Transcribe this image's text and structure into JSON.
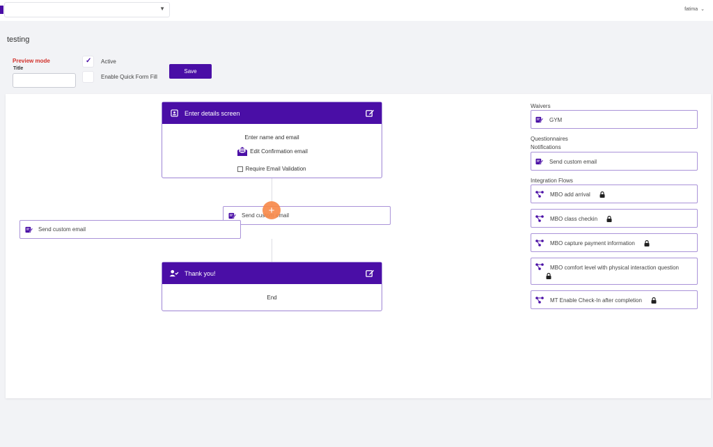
{
  "topbar": {
    "user_name": "fatima"
  },
  "page": {
    "title": "testing"
  },
  "form": {
    "preview_mode_label": "Preview mode",
    "title_label": "Title",
    "title_value": "",
    "active_label": "Active",
    "active_checked": true,
    "quick_fill_label": "Enable Quick Form Fill",
    "quick_fill_checked": false,
    "save_label": "Save"
  },
  "flow": {
    "details_node": {
      "title": "Enter details screen",
      "line1": "Enter name and email",
      "confirmation_link": "Edit Confirmation email",
      "validation_label": "Require Email Validation"
    },
    "middle_action": {
      "label": "Send custom email"
    },
    "left_action": {
      "label": "Send custom email"
    },
    "add_symbol": "+",
    "thanks_node": {
      "title": "Thank you!",
      "body": "End"
    }
  },
  "sidebar": {
    "waivers_label": "Waivers",
    "waivers": [
      {
        "label": "GYM"
      }
    ],
    "questionnaires_label": "Questionnaires",
    "notifications_label": "Notifications",
    "notifications": [
      {
        "label": "Send custom email"
      }
    ],
    "integration_label": "Integration Flows",
    "integrations": [
      {
        "label": "MBO add arrival"
      },
      {
        "label": "MBO class checkin"
      },
      {
        "label": "MBO capture payment information"
      },
      {
        "label": "MBO comfort level with physical interaction question"
      },
      {
        "label": "MT Enable Check-In after completion"
      }
    ]
  },
  "colors": {
    "brand": "#4a0ea6",
    "accent": "#f78a4b",
    "danger": "#d2312b"
  }
}
